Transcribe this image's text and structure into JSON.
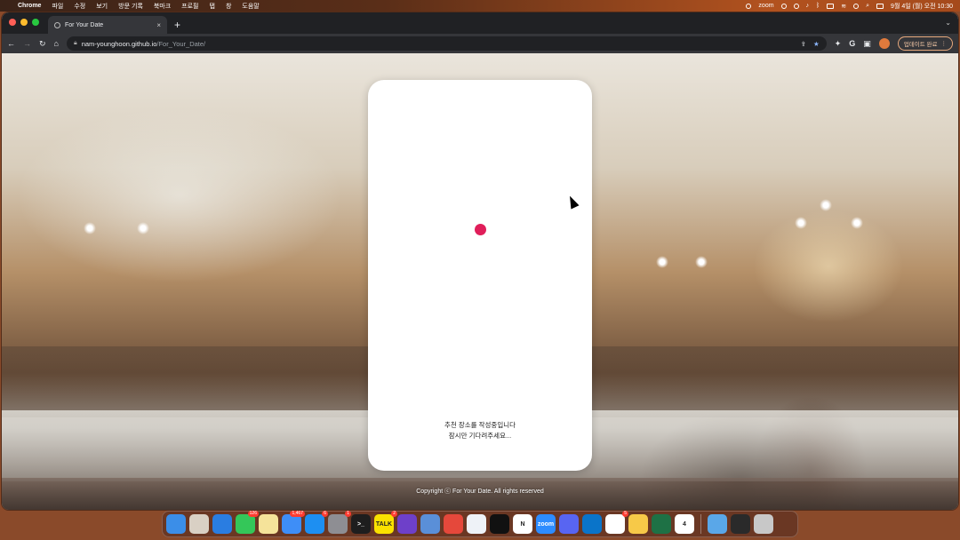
{
  "menubar": {
    "app": "Chrome",
    "items": [
      "파일",
      "수정",
      "보기",
      "방문 기록",
      "북마크",
      "프로필",
      "탭",
      "창",
      "도움말"
    ],
    "zoom_label": "zoom",
    "datetime": "9월 4일 (월) 오전 10:30"
  },
  "browser": {
    "tab_title": "For Your Date",
    "url_host": "nam-younghoon.github.io",
    "url_path": "/For_Your_Date/",
    "update_label": "업데이트 완료"
  },
  "page": {
    "loading_line1": "추천 장소를 작성중입니다",
    "loading_line2": "잠시만 기다려주세요...",
    "copyright": "Copyright ⓒ For Your Date. All rights reserved",
    "accent_color": "#e01e5a"
  },
  "dock": {
    "items": [
      {
        "name": "finder-icon",
        "color": "#3b8ee8",
        "label": "",
        "badge": ""
      },
      {
        "name": "launchpad-icon",
        "color": "#d9d0c4",
        "label": "",
        "badge": ""
      },
      {
        "name": "safari-icon",
        "color": "#2a7de1",
        "label": "",
        "badge": ""
      },
      {
        "name": "messages-icon",
        "color": "#34c759",
        "label": "",
        "badge": "126"
      },
      {
        "name": "notes-icon",
        "color": "#f5e39a",
        "label": "",
        "badge": ""
      },
      {
        "name": "mail-icon",
        "color": "#3e8ef7",
        "label": "",
        "badge": "1,467"
      },
      {
        "name": "app-store-icon",
        "color": "#1d8ff2",
        "label": "",
        "badge": "6"
      },
      {
        "name": "system-settings-icon",
        "color": "#8e8e93",
        "label": "",
        "badge": "1"
      },
      {
        "name": "terminal-icon",
        "color": "#1e1e1e",
        "label": ">_",
        "badge": ""
      },
      {
        "name": "kakaotalk-icon",
        "color": "#fae100",
        "label": "TALK",
        "badge": "2"
      },
      {
        "name": "github-desktop-icon",
        "color": "#6e40c9",
        "label": "",
        "badge": ""
      },
      {
        "name": "blocked-app-icon",
        "color": "#5a8fd8",
        "label": "",
        "badge": ""
      },
      {
        "name": "chrome-icon",
        "color": "#e5483b",
        "label": "",
        "badge": ""
      },
      {
        "name": "word-like-icon",
        "color": "#eef2f7",
        "label": "",
        "badge": ""
      },
      {
        "name": "iterm-icon",
        "color": "#111111",
        "label": "",
        "badge": ""
      },
      {
        "name": "notion-icon",
        "color": "#ffffff",
        "label": "N",
        "badge": ""
      },
      {
        "name": "zoom-icon",
        "color": "#2d8cff",
        "label": "zoom",
        "badge": ""
      },
      {
        "name": "discord-icon",
        "color": "#5865f2",
        "label": "",
        "badge": ""
      },
      {
        "name": "vscode-icon",
        "color": "#0a74c9",
        "label": "",
        "badge": ""
      },
      {
        "name": "slack-icon",
        "color": "#ffffff",
        "label": "",
        "badge": "5"
      },
      {
        "name": "yellow-app-icon",
        "color": "#f7c948",
        "label": "",
        "badge": ""
      },
      {
        "name": "excel-icon",
        "color": "#1e7145",
        "label": "",
        "badge": ""
      },
      {
        "name": "calendar-icon",
        "color": "#ffffff",
        "label": "4",
        "badge": ""
      }
    ],
    "right_items": [
      {
        "name": "folder-icon",
        "color": "#5aa7e8",
        "label": ""
      },
      {
        "name": "screen-icon",
        "color": "#2a2a2a",
        "label": ""
      },
      {
        "name": "trash-icon",
        "color": "#c8c8c8",
        "label": ""
      }
    ]
  }
}
